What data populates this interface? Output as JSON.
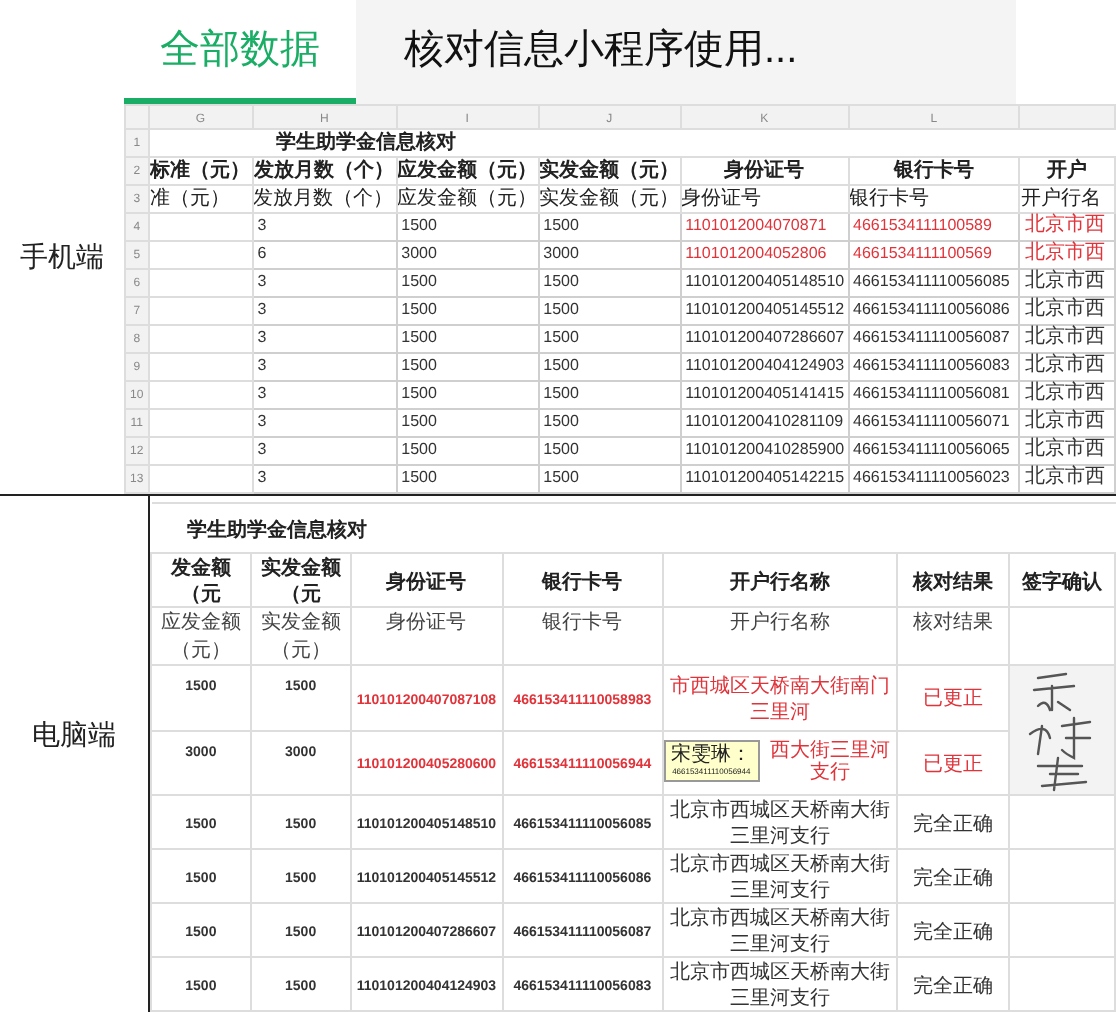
{
  "tabs": [
    {
      "label": "全部数据",
      "selected": true
    },
    {
      "label": "核对信息小程序使用...",
      "selected": false
    }
  ],
  "mobile_label": "手机端",
  "mobile_sheet": {
    "column_letters": [
      "G",
      "H",
      "I",
      "J",
      "K",
      "L"
    ],
    "title_row": {
      "number": "1",
      "title": "学生助学金信息核对"
    },
    "header_bold": {
      "number": "2",
      "cells": [
        "标准（元）",
        "发放月数（个）",
        "应发金额（元）",
        "实发金额（元）",
        "身份证号",
        "银行卡号",
        "开户"
      ]
    },
    "header": {
      "number": "3",
      "cells": [
        "准（元）",
        "发放月数（个）",
        "应发金额（元）",
        "实发金额（元）",
        "身份证号",
        "银行卡号",
        "开户行名"
      ]
    },
    "rows": [
      {
        "number": "4",
        "flagged": true,
        "cells": [
          "3",
          "1500",
          "1500",
          "1101012004070871",
          "4661534111100589",
          "北京市西"
        ]
      },
      {
        "number": "5",
        "flagged": true,
        "cells": [
          "6",
          "3000",
          "3000",
          "1101012004052806",
          "4661534111100569",
          "北京市西"
        ]
      },
      {
        "number": "6",
        "flagged": false,
        "cells": [
          "3",
          "1500",
          "1500",
          "110101200405148510",
          "466153411110056085",
          "北京市西"
        ]
      },
      {
        "number": "7",
        "flagged": false,
        "cells": [
          "3",
          "1500",
          "1500",
          "110101200405145512",
          "466153411110056086",
          "北京市西"
        ]
      },
      {
        "number": "8",
        "flagged": false,
        "cells": [
          "3",
          "1500",
          "1500",
          "110101200407286607",
          "466153411110056087",
          "北京市西"
        ]
      },
      {
        "number": "9",
        "flagged": false,
        "cells": [
          "3",
          "1500",
          "1500",
          "110101200404124903",
          "466153411110056083",
          "北京市西"
        ]
      },
      {
        "number": "10",
        "flagged": false,
        "cells": [
          "3",
          "1500",
          "1500",
          "110101200405141415",
          "466153411110056081",
          "北京市西"
        ]
      },
      {
        "number": "11",
        "flagged": false,
        "cells": [
          "3",
          "1500",
          "1500",
          "110101200410281109",
          "466153411110056071",
          "北京市西"
        ]
      },
      {
        "number": "12",
        "flagged": false,
        "cells": [
          "3",
          "1500",
          "1500",
          "110101200410285900",
          "466153411110056065",
          "北京市西"
        ]
      },
      {
        "number": "13",
        "flagged": false,
        "cells": [
          "3",
          "1500",
          "1500",
          "110101200405142215",
          "466153411110056023",
          "北京市西"
        ]
      }
    ]
  },
  "desktop_label": "电脑端",
  "desktop_sheet": {
    "title": "学生助学金信息核对",
    "header_bold": [
      "发金额（元",
      "实发金额（元",
      "身份证号",
      "银行卡号",
      "开户行名称",
      "核对结果",
      "签字确认"
    ],
    "header": [
      "应发金额（元）",
      "实发金额（元）",
      "身份证号",
      "银行卡号",
      "开户行名称",
      "核对结果"
    ],
    "rows": [
      {
        "flagged": true,
        "cells": [
          "1500",
          "1500",
          "110101200407087108",
          "466153411110058983",
          "市西城区天桥南大街南门三里河",
          "已更正"
        ]
      },
      {
        "flagged": true,
        "cells": [
          "3000",
          "3000",
          "110101200405280600",
          "466153411110056944",
          "西大街三里河支行",
          "已更正"
        ],
        "comment": {
          "author": "宋雯琳：",
          "text": "466153411110056944"
        }
      },
      {
        "flagged": false,
        "cells": [
          "1500",
          "1500",
          "110101200405148510",
          "466153411110056085",
          "北京市西城区天桥南大街三里河支行",
          "完全正确"
        ]
      },
      {
        "flagged": false,
        "cells": [
          "1500",
          "1500",
          "110101200405145512",
          "466153411110056086",
          "北京市西城区天桥南大街三里河支行",
          "完全正确"
        ]
      },
      {
        "flagged": false,
        "cells": [
          "1500",
          "1500",
          "110101200407286607",
          "466153411110056087",
          "北京市西城区天桥南大街三里河支行",
          "完全正确"
        ]
      },
      {
        "flagged": false,
        "cells": [
          "1500",
          "1500",
          "110101200404124903",
          "466153411110056083",
          "北京市西城区天桥南大街三里河支行",
          "完全正确"
        ]
      }
    ]
  }
}
